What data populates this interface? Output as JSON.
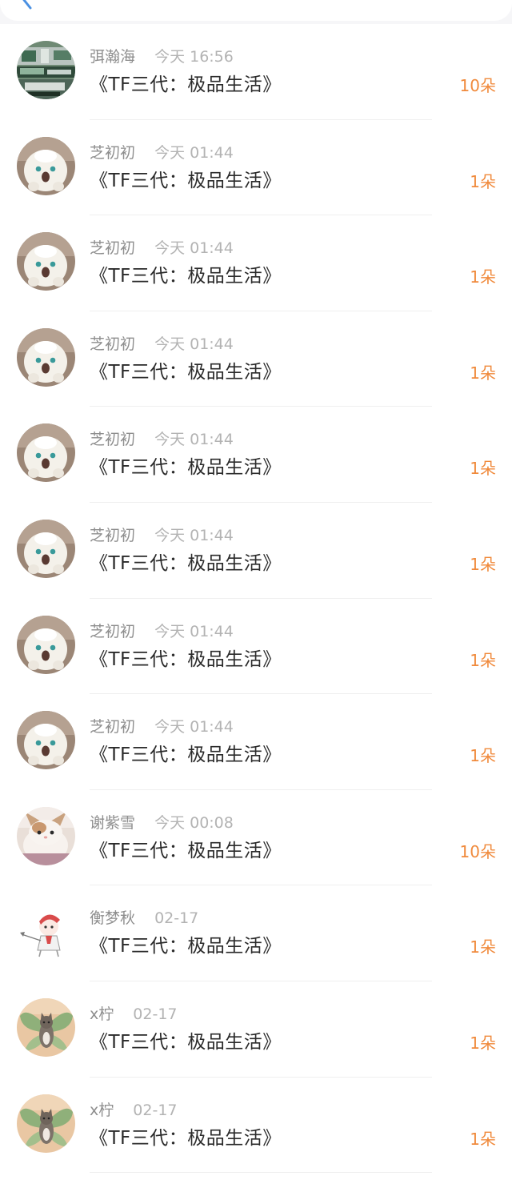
{
  "header": {
    "back_icon": "chevron-left-icon",
    "accent": "#4a90e2"
  },
  "colors": {
    "amount": "#f08a3c",
    "name": "#8e8e8e",
    "time": "#b3b3b3",
    "title": "#2a2a2a"
  },
  "gifts": [
    {
      "avatar": "photo-avatar",
      "name": "弭瀚海",
      "time": "今天 16:56",
      "title": "《TF三代：极品生活》",
      "amount": "10朵"
    },
    {
      "avatar": "plush-avatar",
      "name": "芝初初",
      "time": "今天 01:44",
      "title": "《TF三代：极品生活》",
      "amount": "1朵"
    },
    {
      "avatar": "plush-avatar",
      "name": "芝初初",
      "time": "今天 01:44",
      "title": "《TF三代：极品生活》",
      "amount": "1朵"
    },
    {
      "avatar": "plush-avatar",
      "name": "芝初初",
      "time": "今天 01:44",
      "title": "《TF三代：极品生活》",
      "amount": "1朵"
    },
    {
      "avatar": "plush-avatar",
      "name": "芝初初",
      "time": "今天 01:44",
      "title": "《TF三代：极品生活》",
      "amount": "1朵"
    },
    {
      "avatar": "plush-avatar",
      "name": "芝初初",
      "time": "今天 01:44",
      "title": "《TF三代：极品生活》",
      "amount": "1朵"
    },
    {
      "avatar": "plush-avatar",
      "name": "芝初初",
      "time": "今天 01:44",
      "title": "《TF三代：极品生活》",
      "amount": "1朵"
    },
    {
      "avatar": "plush-avatar",
      "name": "芝初初",
      "time": "今天 01:44",
      "title": "《TF三代：极品生活》",
      "amount": "1朵"
    },
    {
      "avatar": "kitten-avatar",
      "name": "谢紫雪",
      "time": "今天 00:08",
      "title": "《TF三代：极品生活》",
      "amount": "10朵"
    },
    {
      "avatar": "cartoon-avatar",
      "name": "衡梦秋",
      "time": "02-17",
      "title": "《TF三代：极品生活》",
      "amount": "1朵"
    },
    {
      "avatar": "cat-wings-avatar",
      "name": "x柠",
      "time": "02-17",
      "title": "《TF三代：极品生活》",
      "amount": "1朵"
    },
    {
      "avatar": "cat-wings-avatar",
      "name": "x柠",
      "time": "02-17",
      "title": "《TF三代：极品生活》",
      "amount": "1朵"
    }
  ]
}
